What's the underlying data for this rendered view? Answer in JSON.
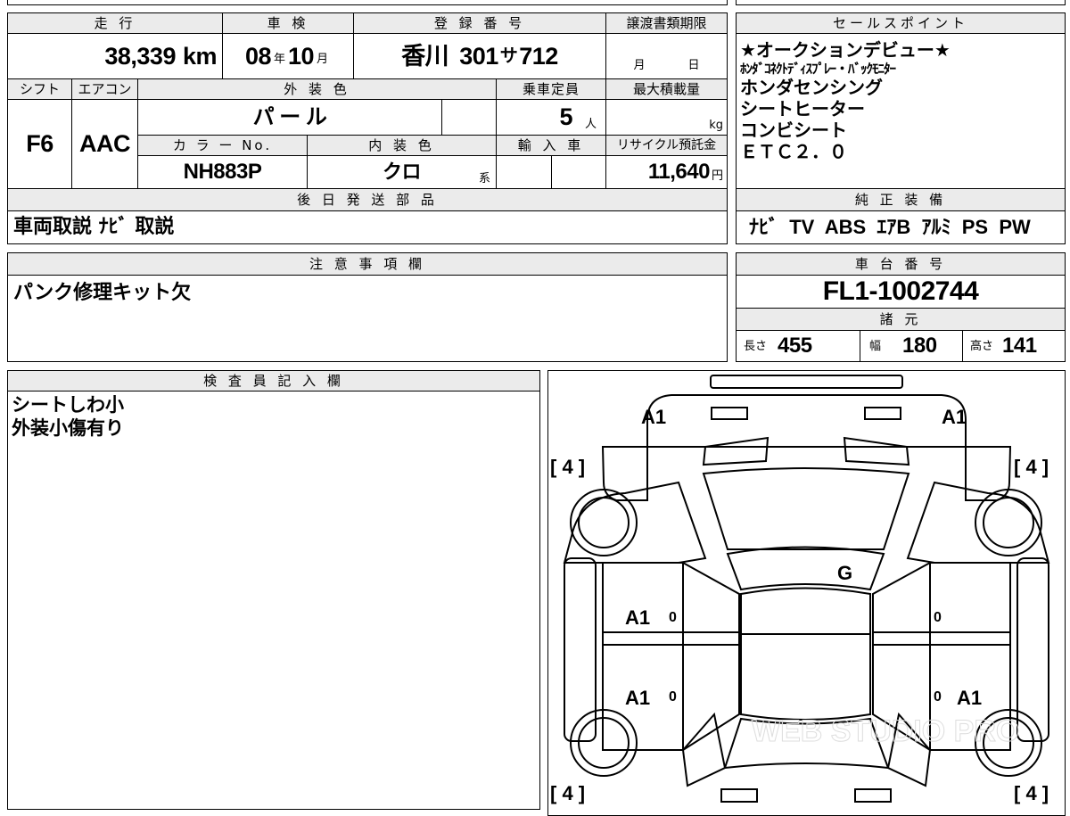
{
  "top_headers": {
    "mileage": "走 行",
    "inspection": "車 検",
    "registration": "登 録 番 号",
    "transfer_deadline": "譲渡書類期限",
    "sales_points": "セールスポイント"
  },
  "mileage": {
    "value": "38,339",
    "unit": "km"
  },
  "inspection": {
    "year": "08",
    "year_unit": "年",
    "month": "10",
    "month_unit": "月"
  },
  "registration": {
    "region": "香川",
    "number": "301",
    "kana": "サ",
    "serial": "712"
  },
  "transfer_deadline": {
    "month_unit": "月",
    "day_unit": "日"
  },
  "row2_headers": {
    "shift": "シフト",
    "aircon": "エアコン",
    "exterior_color": "外 装 色",
    "capacity": "乗車定員",
    "max_load": "最大積載量"
  },
  "shift": "F6",
  "aircon": "AAC",
  "exterior_color": "パ ー ル",
  "capacity": {
    "value": "5",
    "unit": "人"
  },
  "max_load": {
    "unit": "kg"
  },
  "row3_headers": {
    "color_no": "カ ラ ー No.",
    "interior_color": "内 装 色",
    "import": "輸 入 車",
    "recycle": "リサイクル預託金"
  },
  "color_no": "NH883P",
  "interior_color": {
    "value": "クロ",
    "suffix": "系"
  },
  "recycle": {
    "value": "11,640",
    "unit": "円"
  },
  "sales_points": [
    "★オークションデビュー★",
    "ﾎﾝﾀﾞｺﾈｸﾄﾃﾞｨｽﾌﾟﾚｰ・ﾊﾞｯｸﾓﾆﾀｰ",
    "ホンダセンシング",
    "シートヒーター",
    "コンビシート",
    "ＥＴＣ２．０"
  ],
  "later_parts": {
    "header": "後 日 発 送 部 品",
    "value": "車両取説 ﾅﾋﾞ 取説"
  },
  "standard_equipment": {
    "header": "純 正 装 備",
    "value": "ﾅﾋﾞ  TV  ABS  ｴｱB  ｱﾙﾐ  PS  PW"
  },
  "notes": {
    "header": "注 意 事 項 欄",
    "value": "パンク修理キット欠"
  },
  "chassis": {
    "header": "車 台 番 号",
    "value": "FL1-1002744"
  },
  "specs": {
    "header": "諸 元",
    "length_label": "長さ",
    "length": "455",
    "width_label": "幅",
    "width": "180",
    "height_label": "高さ",
    "height": "141"
  },
  "inspector": {
    "header": "検 査 員 記 入 欄",
    "lines": [
      "シートしわ小",
      "外装小傷有り"
    ]
  },
  "diagram": {
    "a1": "A1",
    "g": "G",
    "zero": "0",
    "tire": "[ 4 ]",
    "watermark": "WEB STUDIO PRO"
  }
}
